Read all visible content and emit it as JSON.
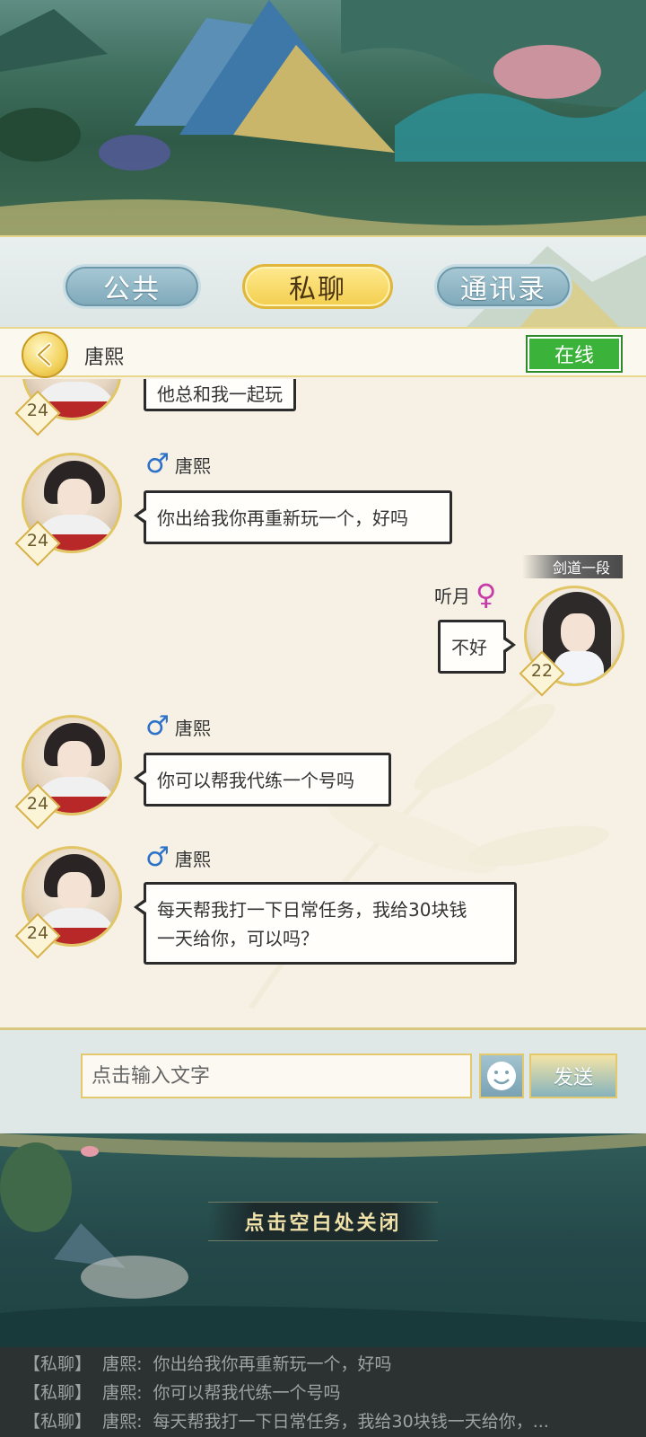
{
  "tabs": [
    {
      "label": "公共",
      "active": false
    },
    {
      "label": "私聊",
      "active": true
    },
    {
      "label": "通讯录",
      "active": false
    }
  ],
  "header": {
    "contact_name": "唐熙",
    "status": "在线",
    "status_color": "#3bb33b"
  },
  "messages": [
    {
      "sender": "唐熙",
      "gender": "male",
      "level": "24",
      "text": "你出给我你再重新玩一个，好吗"
    },
    {
      "sender": "听月",
      "gender": "female",
      "level": "22",
      "title": "剑道一段",
      "text": "不好"
    },
    {
      "sender": "唐熙",
      "gender": "male",
      "level": "24",
      "text": "你可以帮我代练一个号吗"
    },
    {
      "sender": "唐熙",
      "gender": "male",
      "level": "24",
      "text_line1": "每天帮我打一下日常任务，我给30块钱",
      "text_line2": "一天给你，可以吗？"
    }
  ],
  "partial_message": {
    "level": "24",
    "text": "他总和我一起玩"
  },
  "input": {
    "placeholder": "点击输入文字",
    "send_label": "发送"
  },
  "close_hint": "点击空白处关闭",
  "log": [
    {
      "channel": "【私聊】",
      "sender": "唐熙:",
      "text": "你出给我你再重新玩一个，好吗"
    },
    {
      "channel": "【私聊】",
      "sender": "唐熙:",
      "text": "你可以帮我代练一个号吗"
    },
    {
      "channel": "【私聊】",
      "sender": "唐熙:",
      "text": "每天帮我打一下日常任务，我给30块钱一天给你，..."
    }
  ],
  "icons": {
    "male": "male-symbol-icon",
    "female": "female-symbol-icon",
    "back": "chevron-left-icon",
    "emoji": "smiley-icon"
  },
  "colors": {
    "accent_gold": "#f3cf4f",
    "tab_blue": "#7ea8b9",
    "panel_bg": "#f6f1e4"
  }
}
